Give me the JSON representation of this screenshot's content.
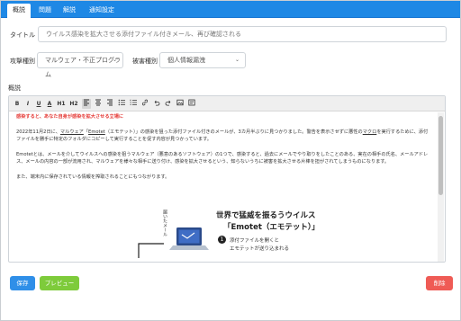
{
  "tabs": [
    {
      "label": "概説"
    },
    {
      "label": "問題"
    },
    {
      "label": "解説"
    },
    {
      "label": "通知設定"
    }
  ],
  "form": {
    "title_label": "タイトル",
    "title_value": "ウイルス感染を拡大させる添付ファイル付きメール、再び確認される",
    "attack_label": "攻撃種別",
    "attack_value": "マルウェア・不正プログラム",
    "damage_label": "被害種別",
    "damage_value": "個人情報漏洩",
    "overview_label": "概説"
  },
  "toolbar": {
    "bold": "B",
    "italic": "I",
    "underline": "U",
    "font_color": "A",
    "h1": "H1",
    "h2": "H2"
  },
  "content": {
    "warning": "感染すると、あなた自身が感染を拡大させる立場に",
    "p1_a": "2022年11月2日に、",
    "p1_malware": "マルウェア",
    "p1_b": "「",
    "p1_emotet": "Emotet",
    "p1_c": "（エモテット）」の感染を狙った添付ファイル付きのメールが、3カ月半ぶりに見つかりました。警告を表示させずに悪性の",
    "p1_macro": "マクロ",
    "p1_d": "を実行するために、添付ファイルを勝手に特定のフォルダにコピーして実行することを促す内容が見つかっています。",
    "p2": "Emotetとは、メールを介してウイルスへの感染を狙うマルウェア（悪意のあるソフトウェア）の1つで、感染すると、過去にメールでやり取りをしたことのある、実在の相手の氏名、メールアドレス、メールの内容の一部が流用され、マルウェアを様々な相手に送り付け、感染を拡大させるという、知らないうちに被害を拡大させる片棒を担がされてしまうものになります。",
    "p3": "また、端末内に保存されている情報を搾取されることにもつながります。",
    "figure_side": "届いたメール",
    "figure_title_1": "世界で猛威を振るうウイルス",
    "figure_title_2": "「Emotet（エモテット）」",
    "figure_step_num": "1",
    "figure_step_1": "添付ファイルを開くと",
    "figure_step_2": "エモテットが送り込まれる"
  },
  "buttons": {
    "save": "保存",
    "preview": "プレビュー",
    "delete": "削除"
  },
  "colors": {
    "tabbar": "#1e88e5",
    "save": "#2f8fe8",
    "preview": "#7ecb3b",
    "delete": "#ef5b55",
    "warning": "#e53935"
  }
}
